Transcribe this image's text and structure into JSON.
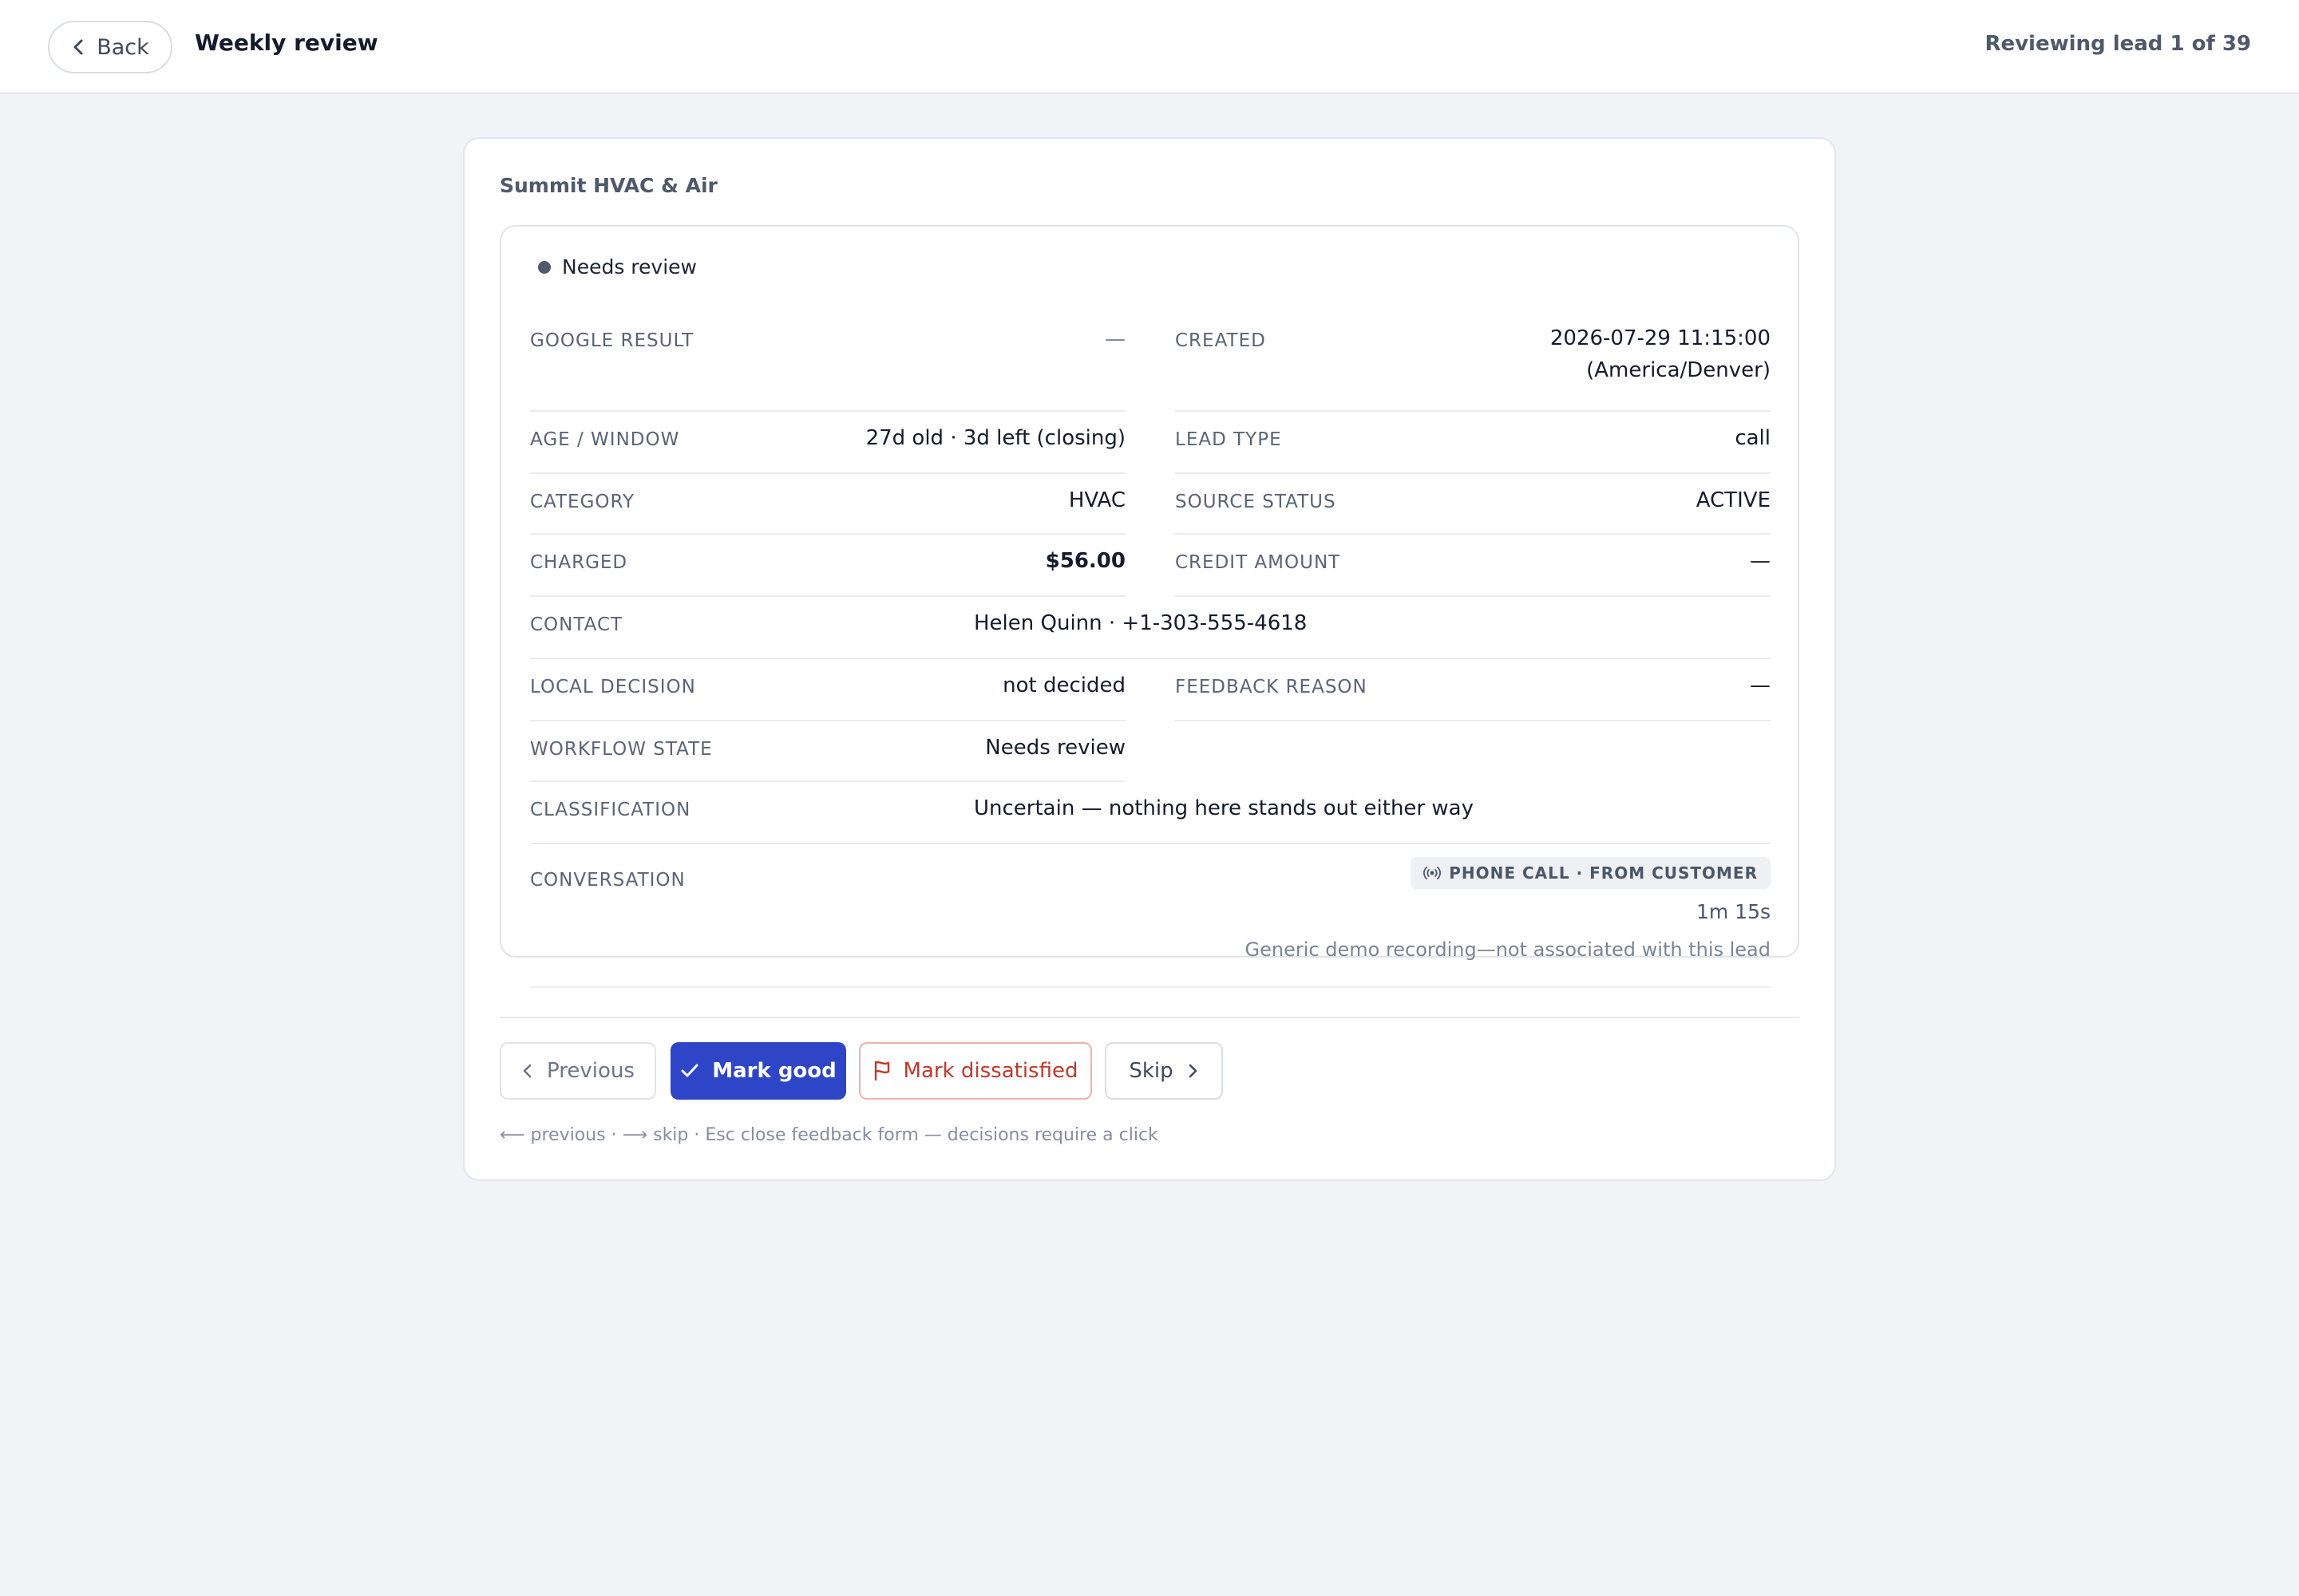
{
  "header": {
    "back_label": "Back",
    "title": "Weekly review",
    "progress": "Reviewing lead 1 of 39"
  },
  "lead": {
    "business_name": "Summit HVAC & Air",
    "status": "Needs review",
    "fields": {
      "google_result": {
        "label": "GOOGLE RESULT",
        "value": "—"
      },
      "created": {
        "label": "CREATED",
        "value_line1": "2026-07-29 11:15:00",
        "value_line2": "(America/Denver)"
      },
      "age_window": {
        "label": "AGE / WINDOW",
        "value": "27d old · 3d left (closing)"
      },
      "lead_type": {
        "label": "LEAD TYPE",
        "value": "call"
      },
      "category": {
        "label": "CATEGORY",
        "value": "HVAC"
      },
      "source_status": {
        "label": "SOURCE STATUS",
        "value": "ACTIVE"
      },
      "charged": {
        "label": "CHARGED",
        "value": "$56.00"
      },
      "credit_amount": {
        "label": "CREDIT AMOUNT",
        "value": "—"
      },
      "contact": {
        "label": "CONTACT",
        "value": "Helen Quinn · +1-303-555-4618"
      },
      "local_decision": {
        "label": "LOCAL DECISION",
        "value": "not decided"
      },
      "feedback_reason": {
        "label": "FEEDBACK REASON",
        "value": "—"
      },
      "workflow_state": {
        "label": "WORKFLOW STATE",
        "value": "Needs review"
      },
      "classification": {
        "label": "CLASSIFICATION",
        "value": "Uncertain — nothing here stands out either way"
      },
      "conversation": {
        "label": "CONVERSATION",
        "chip": "PHONE CALL · FROM CUSTOMER",
        "chip_icon": "broadcast-icon",
        "duration": "1m 15s",
        "note": "Generic demo recording—not associated with this lead"
      }
    }
  },
  "actions": {
    "previous": "Previous",
    "mark_good": "Mark good",
    "mark_dissatisfied": "Mark dissatisfied",
    "skip": "Skip"
  },
  "hint": "⟵ previous · ⟶ skip · Esc close feedback form — decisions require a click",
  "colors": {
    "primary": "#2d45c6",
    "danger": "#c0392b",
    "background": "#f2f3f6"
  }
}
